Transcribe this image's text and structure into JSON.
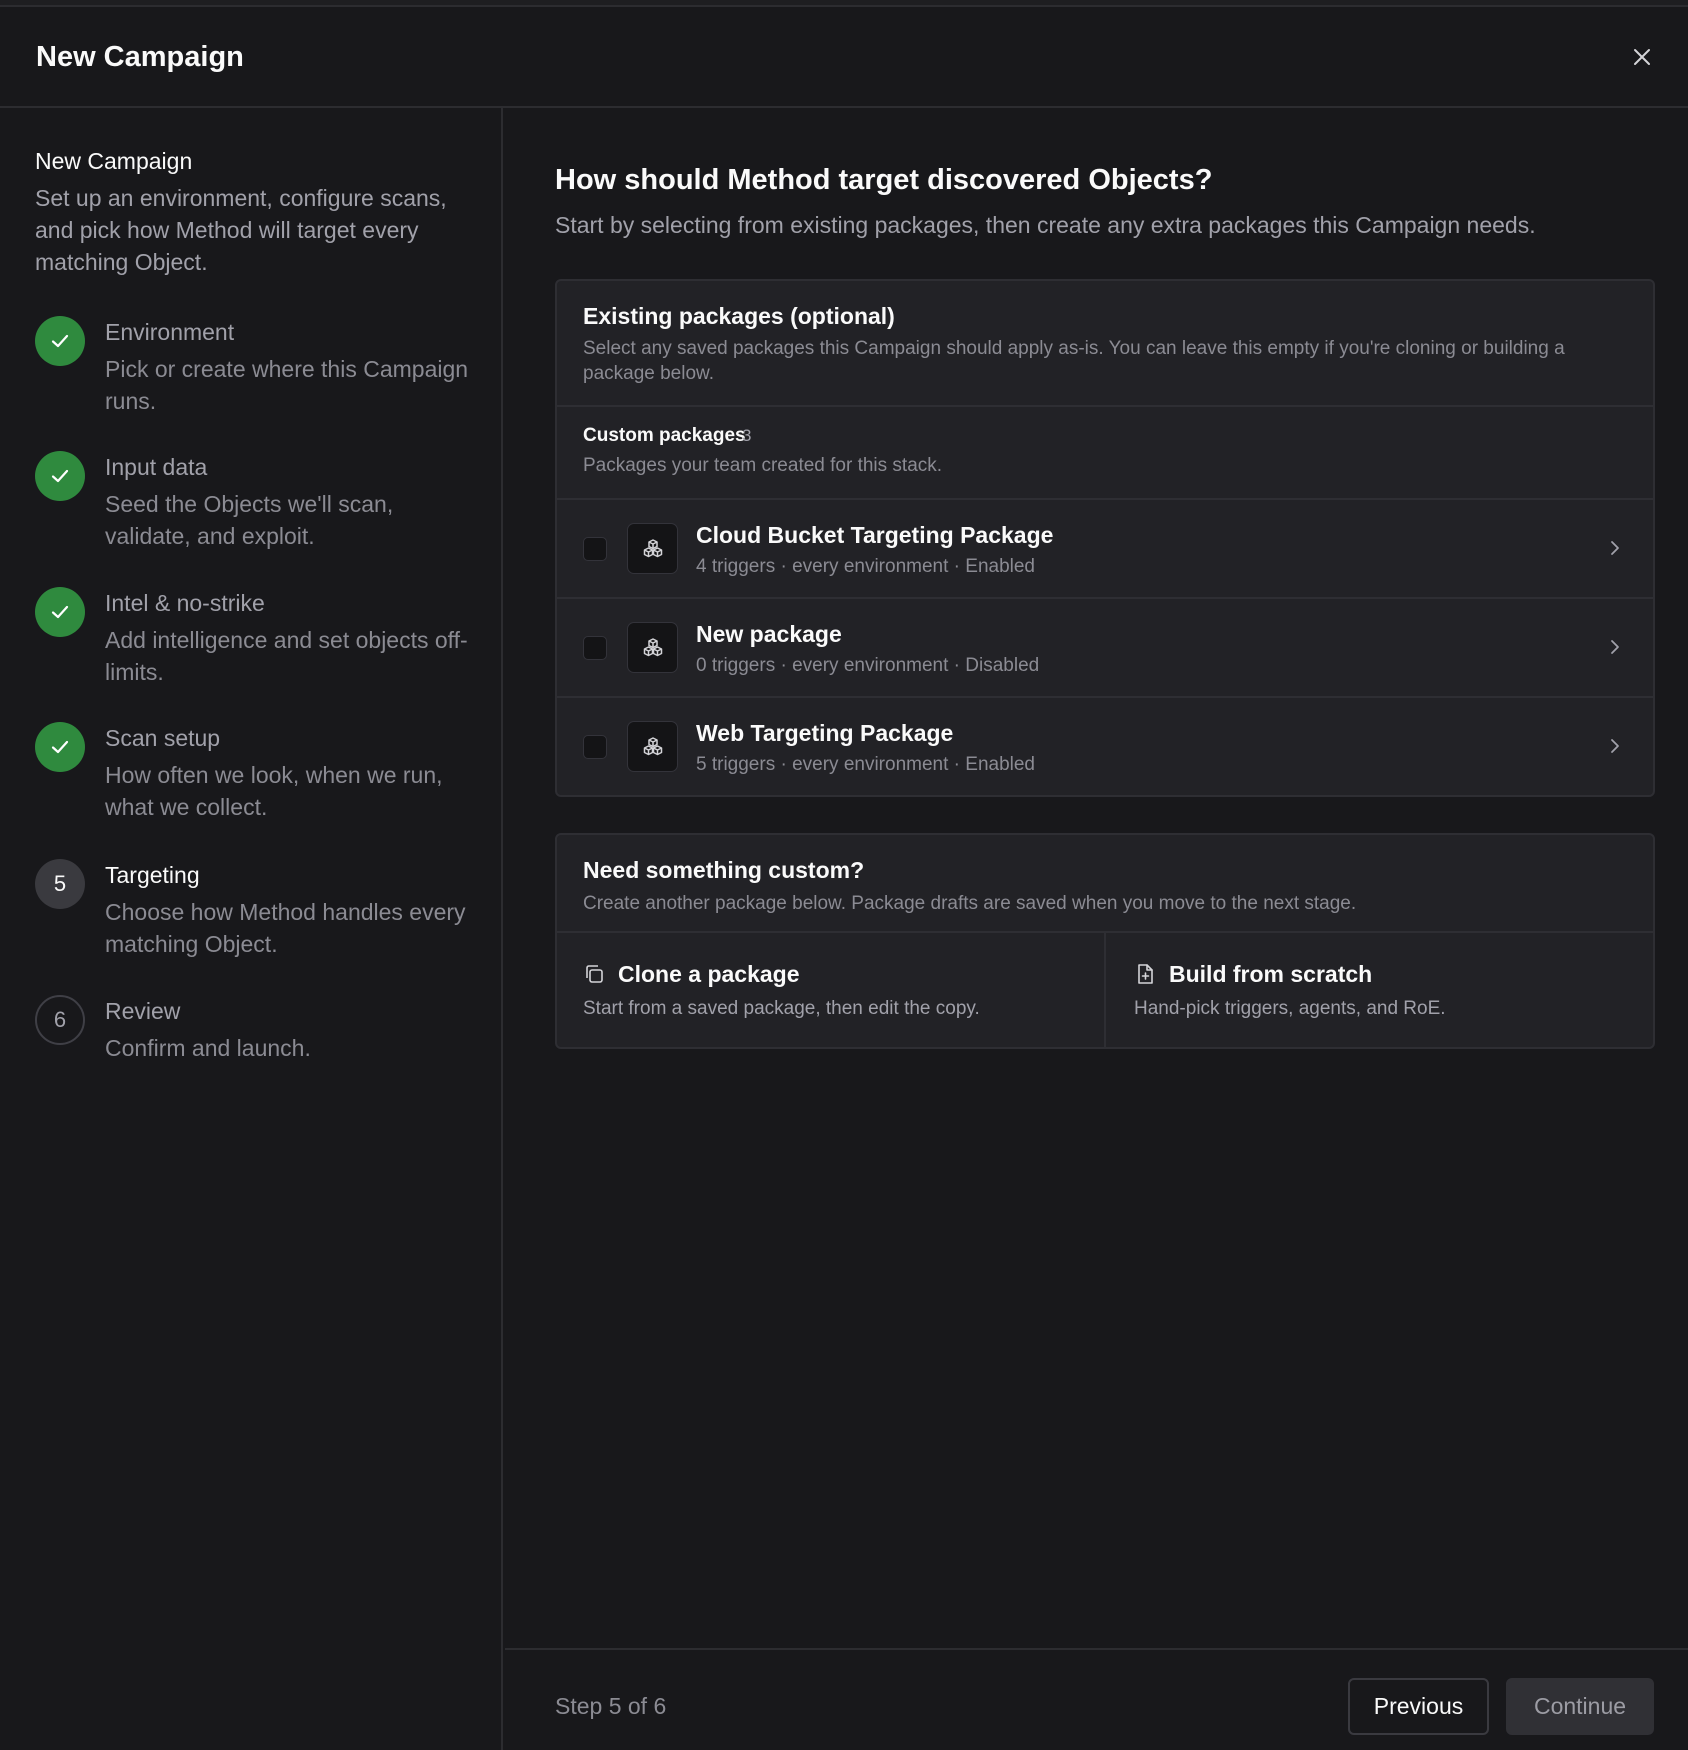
{
  "header": {
    "title": "New Campaign"
  },
  "sidebar": {
    "title": "New Campaign",
    "description": "Set up an environment, configure scans, and pick how Method will target every matching Object.",
    "steps": [
      {
        "number": "1",
        "name": "Environment",
        "description": "Pick or create where this Campaign runs.",
        "status": "done"
      },
      {
        "number": "2",
        "name": "Input data",
        "description": "Seed the Objects we'll scan, validate, and exploit.",
        "status": "done"
      },
      {
        "number": "3",
        "name": "Intel & no-strike",
        "description": "Add intelligence and set objects off-limits.",
        "status": "done"
      },
      {
        "number": "4",
        "name": "Scan setup",
        "description": "How often we look, when we run, what we collect.",
        "status": "done"
      },
      {
        "number": "5",
        "name": "Targeting",
        "description": "Choose how Method handles every matching Object.",
        "status": "active"
      },
      {
        "number": "6",
        "name": "Review",
        "description": "Confirm and launch.",
        "status": "todo"
      }
    ]
  },
  "main": {
    "title": "How should Method target discovered Objects?",
    "subtitle": "Start by selecting from existing packages, then create any extra packages this Campaign needs.",
    "existing": {
      "title": "Existing packages (optional)",
      "description": "Select any saved packages this Campaign should apply as-is. You can leave this empty if you're cloning or building a package below.",
      "group": {
        "title": "Custom packages",
        "count": "3",
        "description": "Packages your team created for this stack."
      },
      "packages": [
        {
          "name": "Cloud Bucket Targeting Package",
          "meta": "4 triggers · every environment · Enabled"
        },
        {
          "name": "New package",
          "meta": "0 triggers · every environment · Disabled"
        },
        {
          "name": "Web Targeting Package",
          "meta": "5 triggers · every environment · Enabled"
        }
      ]
    },
    "custom": {
      "title": "Need something custom?",
      "description": "Create another package below. Package drafts are saved when you move to the next stage.",
      "options": [
        {
          "name": "Clone a package",
          "description": "Start from a saved package, then edit the copy.",
          "icon": "copy-icon"
        },
        {
          "name": "Build from scratch",
          "description": "Hand-pick triggers, agents, and RoE.",
          "icon": "file-plus-icon"
        }
      ]
    }
  },
  "footer": {
    "step_label": "Step 5 of 6",
    "previous_label": "Previous",
    "continue_label": "Continue"
  },
  "colors": {
    "success": "#2f8a3e",
    "background": "#18181b",
    "card": "#222226"
  }
}
